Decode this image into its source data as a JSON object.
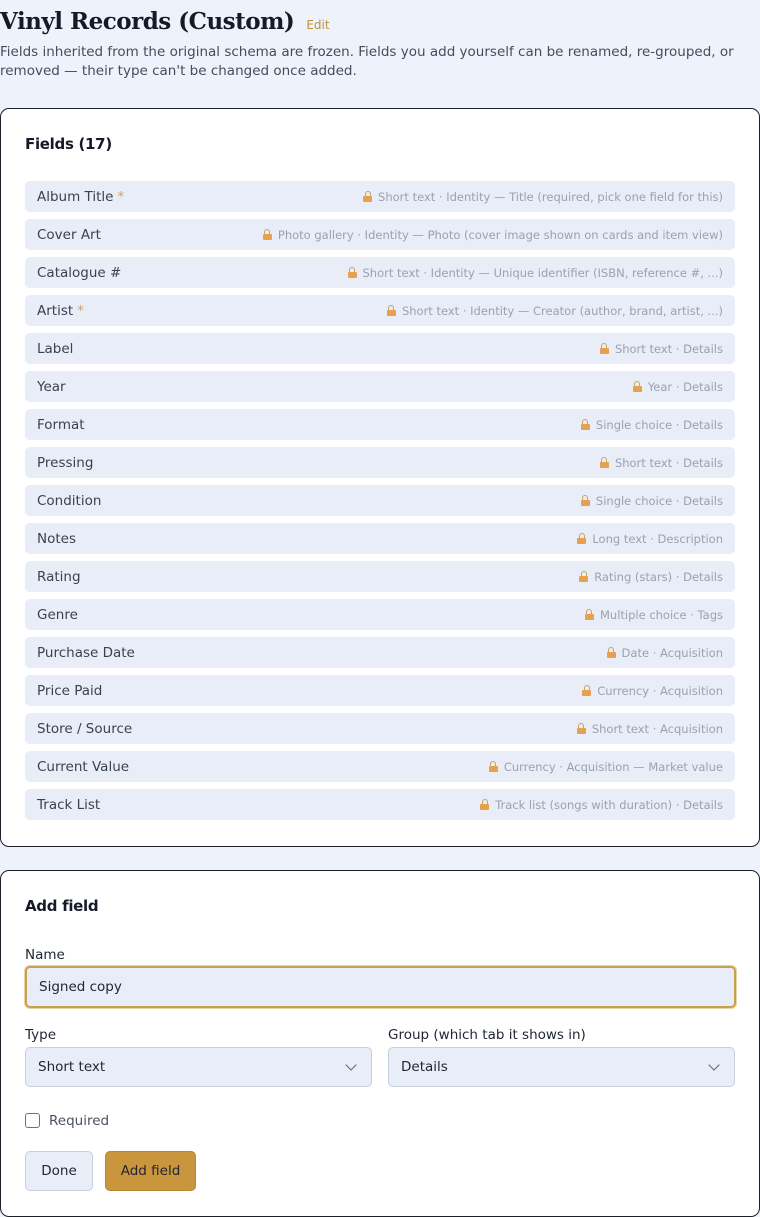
{
  "header": {
    "title": "Vinyl Records (Custom)",
    "edit_label": "Edit",
    "description": "Fields inherited from the original schema are frozen. Fields you add yourself can be renamed, re-grouped, or removed — their type can't be changed once added."
  },
  "fields_card": {
    "title": "Fields (17)",
    "fields": [
      {
        "name": "Album Title",
        "required": "*",
        "meta": "Short text · Identity — Title (required, pick one field for this)"
      },
      {
        "name": "Cover Art",
        "required": "",
        "meta": "Photo gallery · Identity — Photo (cover image shown on cards and item view)"
      },
      {
        "name": "Catalogue #",
        "required": "",
        "meta": "Short text · Identity — Unique identifier (ISBN, reference #, ...)"
      },
      {
        "name": "Artist",
        "required": "*",
        "meta": "Short text · Identity — Creator (author, brand, artist, ...)"
      },
      {
        "name": "Label",
        "required": "",
        "meta": "Short text · Details"
      },
      {
        "name": "Year",
        "required": "",
        "meta": "Year · Details"
      },
      {
        "name": "Format",
        "required": "",
        "meta": "Single choice · Details"
      },
      {
        "name": "Pressing",
        "required": "",
        "meta": "Short text · Details"
      },
      {
        "name": "Condition",
        "required": "",
        "meta": "Single choice · Details"
      },
      {
        "name": "Notes",
        "required": "",
        "meta": "Long text · Description"
      },
      {
        "name": "Rating",
        "required": "",
        "meta": "Rating (stars) · Details"
      },
      {
        "name": "Genre",
        "required": "",
        "meta": "Multiple choice · Tags"
      },
      {
        "name": "Purchase Date",
        "required": "",
        "meta": "Date · Acquisition"
      },
      {
        "name": "Price Paid",
        "required": "",
        "meta": "Currency · Acquisition"
      },
      {
        "name": "Store / Source",
        "required": "",
        "meta": "Short text · Acquisition"
      },
      {
        "name": "Current Value",
        "required": "",
        "meta": "Currency · Acquisition — Market value"
      },
      {
        "name": "Track List",
        "required": "",
        "meta": "Track list (songs with duration) · Details"
      }
    ]
  },
  "add_field": {
    "title": "Add field",
    "name_label": "Name",
    "name_value": "Signed copy",
    "type_label": "Type",
    "type_value": "Short text",
    "group_label": "Group (which tab it shows in)",
    "group_value": "Details",
    "required_label": "Required",
    "required_checked": false,
    "done_label": "Done",
    "add_label": "Add field"
  },
  "colors": {
    "accent": "#c9963e",
    "page_bg": "#eef2fb",
    "row_bg": "#e8edf7",
    "required_star": "#d4a06a",
    "lock_icon": "#e6a14e"
  },
  "icons": {
    "locked_field": "lock-icon",
    "select_dropdown": "chevron-down-icon"
  }
}
